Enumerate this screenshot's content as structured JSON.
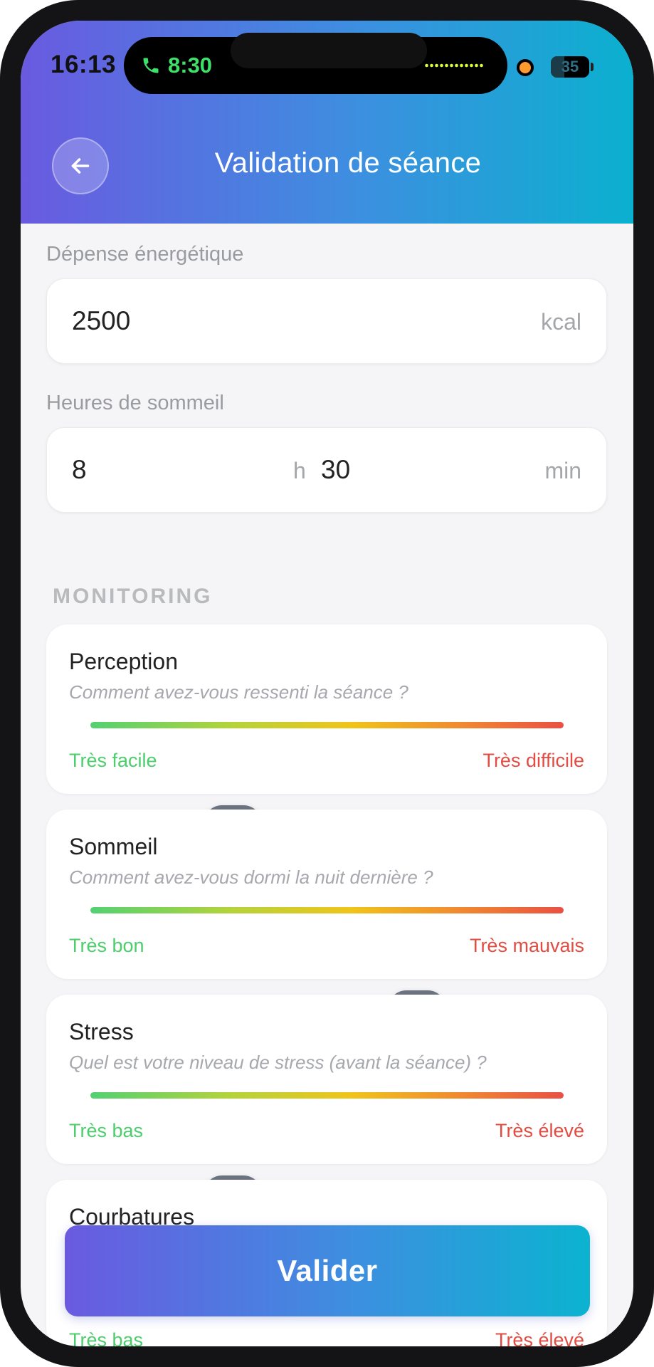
{
  "status_bar": {
    "time": "16:13",
    "call_time": "8:30",
    "battery": "35",
    "battery_level": 0.35
  },
  "header": {
    "title": "Validation de séance",
    "back_icon": "arrow-left-icon"
  },
  "energy": {
    "label": "Dépense énergétique",
    "value": "2500",
    "unit": "kcal"
  },
  "sleep_hours": {
    "label": "Heures de sommeil",
    "hours_value": "8",
    "hours_unit": "h",
    "minutes_value": "30",
    "minutes_unit": "min"
  },
  "monitoring": {
    "section_title": "MONITORING",
    "items": [
      {
        "title": "Perception",
        "subtitle": "Comment avez-vous ressenti la séance ?",
        "low_label": "Très facile",
        "high_label": "Très difficile",
        "value": 0.3
      },
      {
        "title": "Sommeil",
        "subtitle": "Comment avez-vous dormi la nuit dernière ?",
        "low_label": "Très bon",
        "high_label": "Très mauvais",
        "value": 0.69
      },
      {
        "title": "Stress",
        "subtitle": "Quel est votre niveau de stress (avant la séance) ?",
        "low_label": "Très bas",
        "high_label": "Très élevé",
        "value": 0.3
      },
      {
        "title": "Courbatures",
        "subtitle": "",
        "low_label": "Très bas",
        "high_label": "Très élevé",
        "value": null
      }
    ]
  },
  "actions": {
    "validate_label": "Valider"
  },
  "colors": {
    "gradient_start": "#6a5ae0",
    "gradient_end": "#0bb0cf",
    "low_label": "#4bce6b",
    "high_label": "#e24c42",
    "thumb": "#6b7380"
  }
}
